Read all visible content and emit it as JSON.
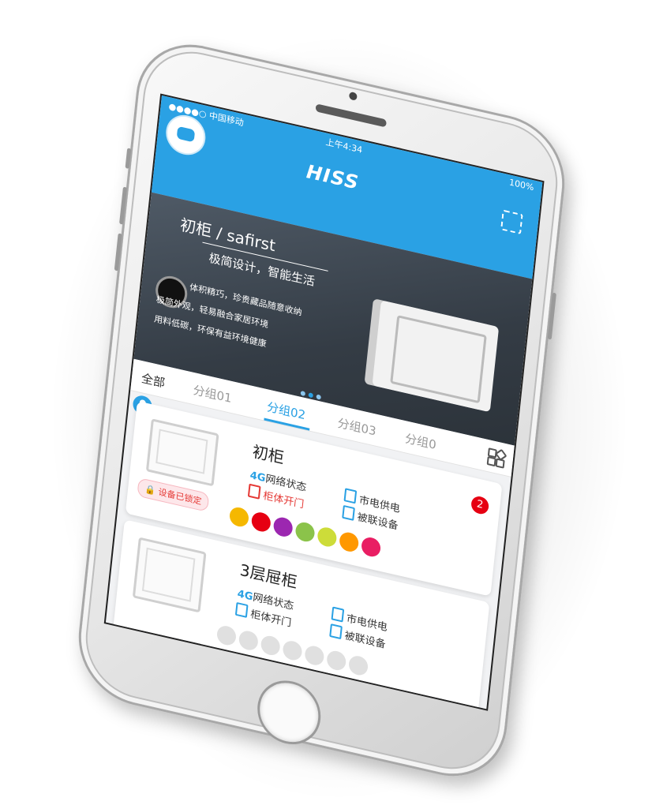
{
  "status": {
    "carrier": "●●●●○ 中国移动",
    "time": "上午4:34",
    "battery": "100%"
  },
  "app": {
    "logo": "HISS"
  },
  "banner": {
    "title": "初柜 / safirst",
    "subtitle": "极简设计，智能生活",
    "lines": [
      "体积精巧，珍贵藏品随意收纳",
      "极简外观，轻易融合家居环境",
      "用料低碳，环保有益环境健康"
    ]
  },
  "tabs": [
    {
      "label": "全部",
      "active": false
    },
    {
      "label": "分组01",
      "active": false
    },
    {
      "label": "分组02",
      "active": true
    },
    {
      "label": "分组03",
      "active": false
    },
    {
      "label": "分组0",
      "active": false
    }
  ],
  "devices": [
    {
      "name": "初柜",
      "network": {
        "tag": "4G",
        "label": "网络状态"
      },
      "power": "市电供电",
      "door": "柜体开门",
      "linked": "被联设备",
      "lock_badge": "设备已锁定",
      "badge_count": "2",
      "status_colors": [
        "#f5b800",
        "#e60012",
        "#9c27b0",
        "#8bc34a",
        "#cddc39",
        "#ff9800",
        "#e91e63"
      ]
    },
    {
      "name": "3层屉柜",
      "network": {
        "tag": "4G",
        "label": "网络状态"
      },
      "power": "市电供电",
      "door": "柜体开门",
      "linked": "被联设备",
      "status_colors": [
        "#e0e0e0",
        "#e0e0e0",
        "#e0e0e0",
        "#e0e0e0",
        "#e0e0e0",
        "#e0e0e0",
        "#e0e0e0"
      ]
    }
  ],
  "colors": {
    "accent": "#2aa1e4",
    "alert": "#e60012"
  }
}
